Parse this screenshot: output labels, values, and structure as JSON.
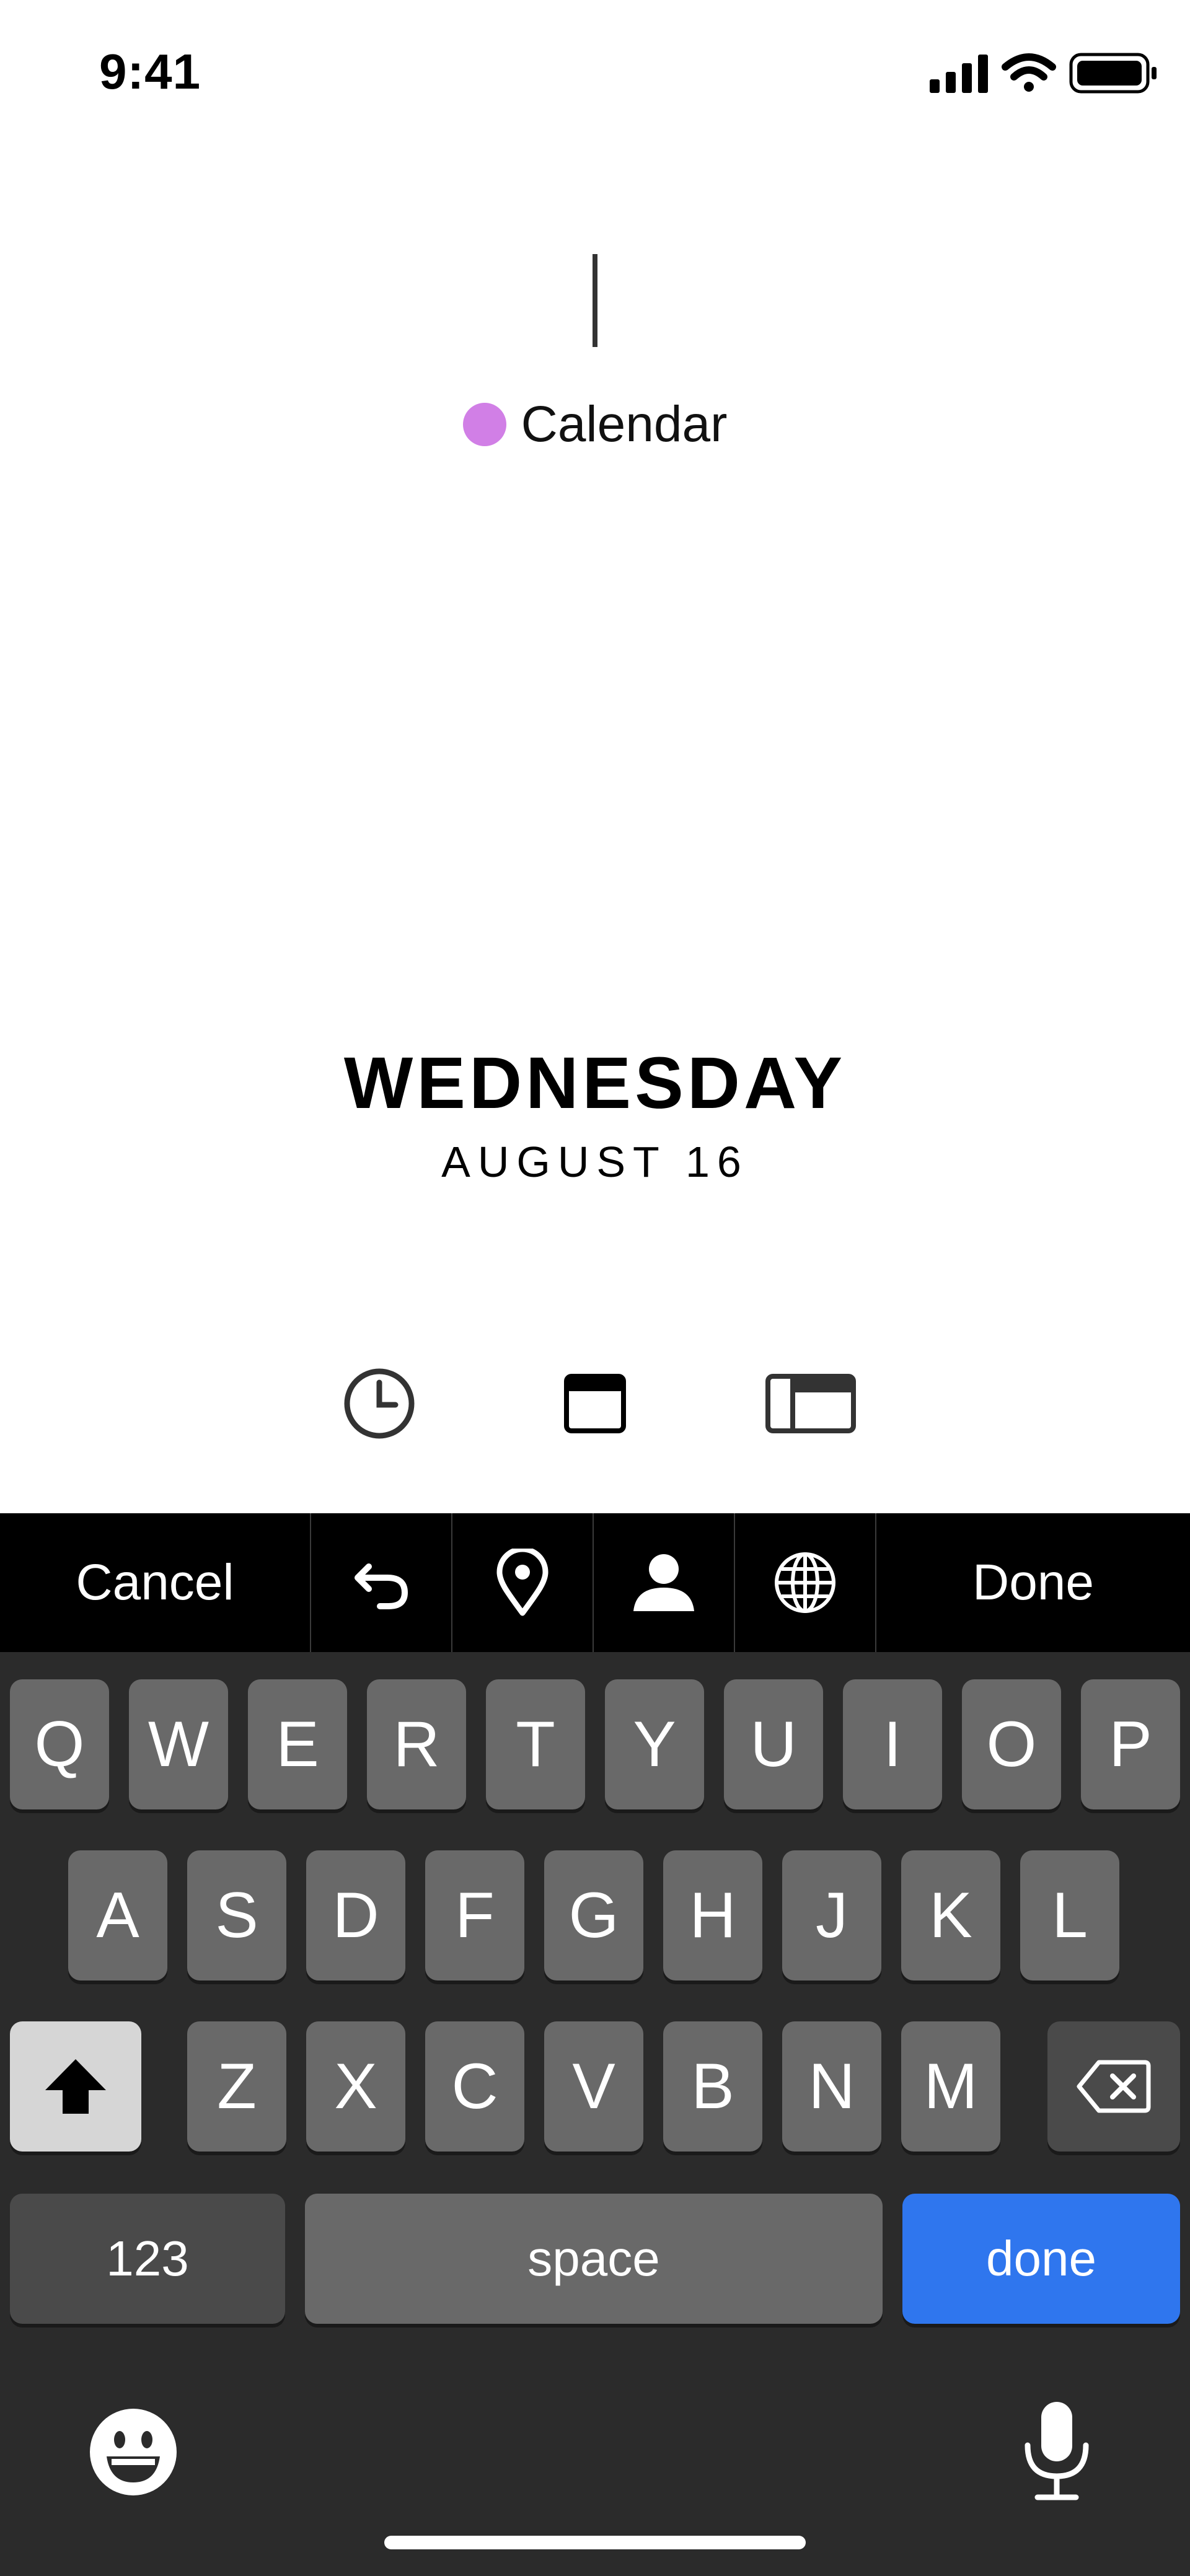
{
  "status": {
    "time": "9:41"
  },
  "event": {
    "calendar_label": "Calendar",
    "calendar_color": "#d17fe6"
  },
  "date": {
    "weekday": "WEDNESDAY",
    "month_day": "AUGUST 16"
  },
  "view_icons": [
    "clock-icon",
    "day-view-icon",
    "split-view-icon"
  ],
  "toolbar": {
    "cancel": "Cancel",
    "done": "Done"
  },
  "keyboard": {
    "row1": [
      "Q",
      "W",
      "E",
      "R",
      "T",
      "Y",
      "U",
      "I",
      "O",
      "P"
    ],
    "row2": [
      "A",
      "S",
      "D",
      "F",
      "G",
      "H",
      "J",
      "K",
      "L"
    ],
    "row3": [
      "Z",
      "X",
      "C",
      "V",
      "B",
      "N",
      "M"
    ],
    "numbers": "123",
    "space": "space",
    "done": "done"
  },
  "colors": {
    "accent": "#2f76ee",
    "keyboard_bg": "#2b2b2b",
    "key": "#696969"
  }
}
